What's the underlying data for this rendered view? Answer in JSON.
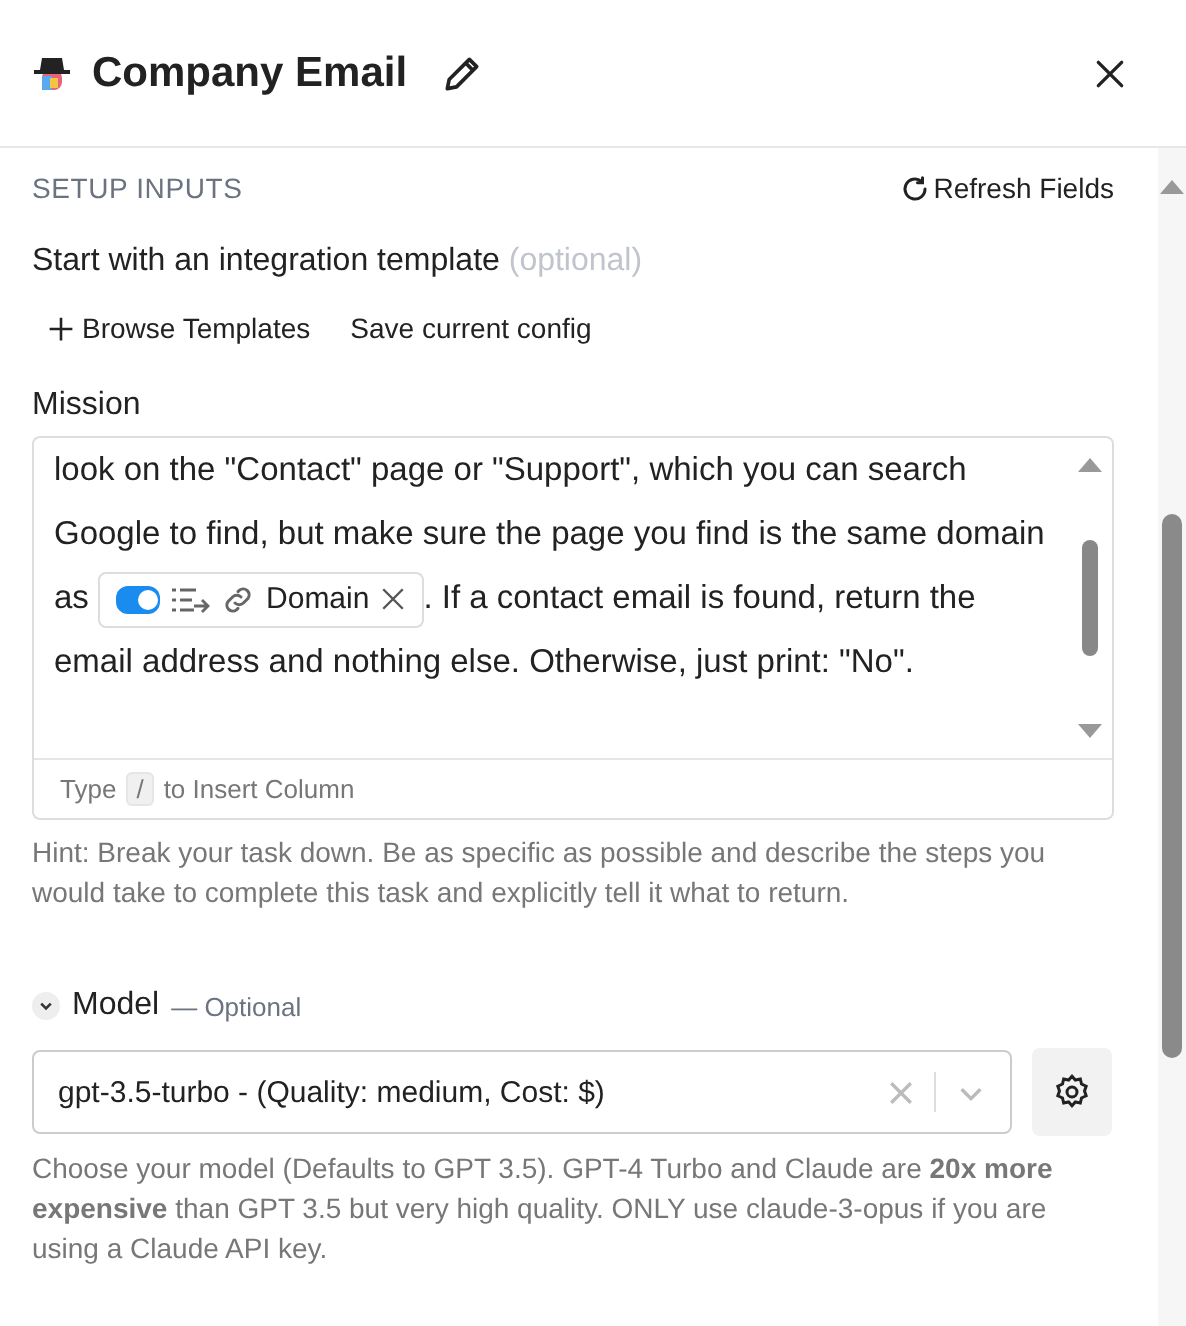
{
  "header": {
    "title": "Company Email"
  },
  "setup": {
    "heading": "SETUP INPUTS",
    "refresh": "Refresh Fields"
  },
  "template": {
    "label": "Start with an integration template",
    "optional": "(optional)",
    "actions": [
      {
        "label": "Browse Templates",
        "kind": "add"
      },
      {
        "label": "Save current config",
        "kind": "plain"
      }
    ]
  },
  "mission": {
    "label": "Mission",
    "text_before": "look on the \"Contact\" page or \"Support\", which you can search Google to find, but make sure the page you find is the same domain as",
    "chip": {
      "label": "Domain",
      "on": true
    },
    "text_after": ". If a contact email is found, return the email address and nothing else. Otherwise, just print: \"No\".",
    "footer_before": "Type",
    "footer_key": "/",
    "footer_after": "to Insert Column",
    "hint": "Hint: Break your task down. Be as specific as possible and describe the steps you would take to complete this task and explicitly tell it what to return."
  },
  "model": {
    "expanded": true,
    "label": "Model",
    "optional": "— Optional",
    "value": "gpt-3.5-turbo - (Quality: medium, Cost: $)",
    "description": "Choose your model (Defaults to GPT 3.5). GPT-4 Turbo and Claude are **20x more expensive** than GPT 3.5 but very high quality. ONLY use claude-3-opus if you are using a Claude API key."
  }
}
